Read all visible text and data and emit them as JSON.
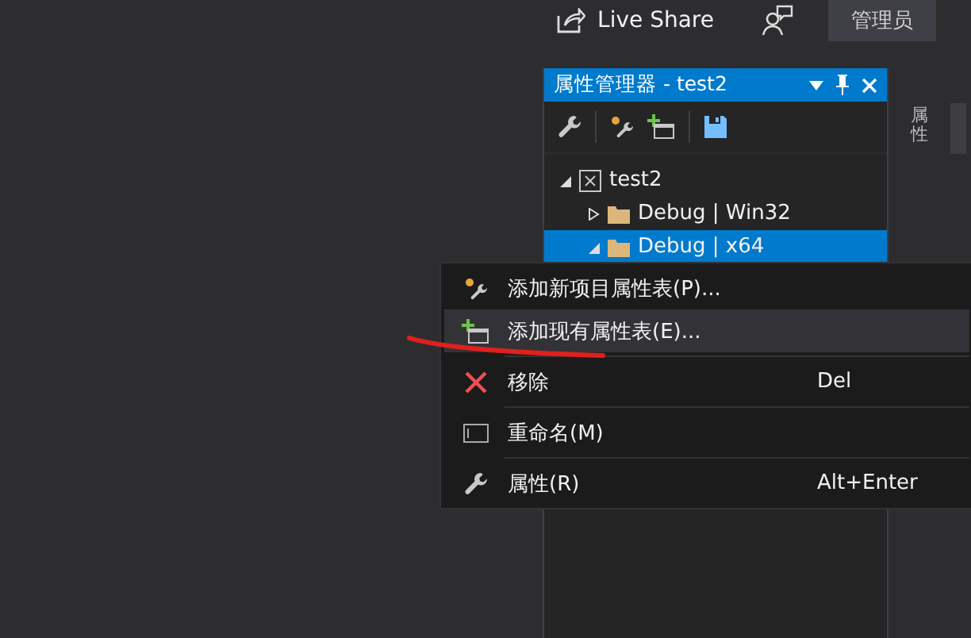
{
  "top_bar": {
    "live_share": "Live Share",
    "user_button": "管理员"
  },
  "panel": {
    "title": "属性管理器 - test2",
    "side_tab": "属性",
    "tree": [
      {
        "label": "test2",
        "kind": "project",
        "expanded": true,
        "selected": false,
        "children": [
          {
            "label": "Debug | Win32",
            "kind": "folder",
            "expanded": false,
            "selected": false
          },
          {
            "label": "Debug | x64",
            "kind": "folder",
            "expanded": true,
            "selected": true
          }
        ]
      }
    ]
  },
  "context_menu": {
    "items": [
      {
        "label": "添加新项目属性表(P)...",
        "kind": "new",
        "selected": false,
        "separator_after": false
      },
      {
        "label": "添加现有属性表(E)...",
        "kind": "existing",
        "selected": true,
        "separator_after": true
      },
      {
        "label": "移除",
        "kind": "remove",
        "shortcut": "Del",
        "selected": false,
        "separator_after": true
      },
      {
        "label": "重命名(M)",
        "kind": "rename",
        "selected": false,
        "separator_after": true
      },
      {
        "label": "属性(R)",
        "kind": "properties",
        "shortcut": "Alt+Enter",
        "selected": false,
        "separator_after": false
      }
    ]
  }
}
